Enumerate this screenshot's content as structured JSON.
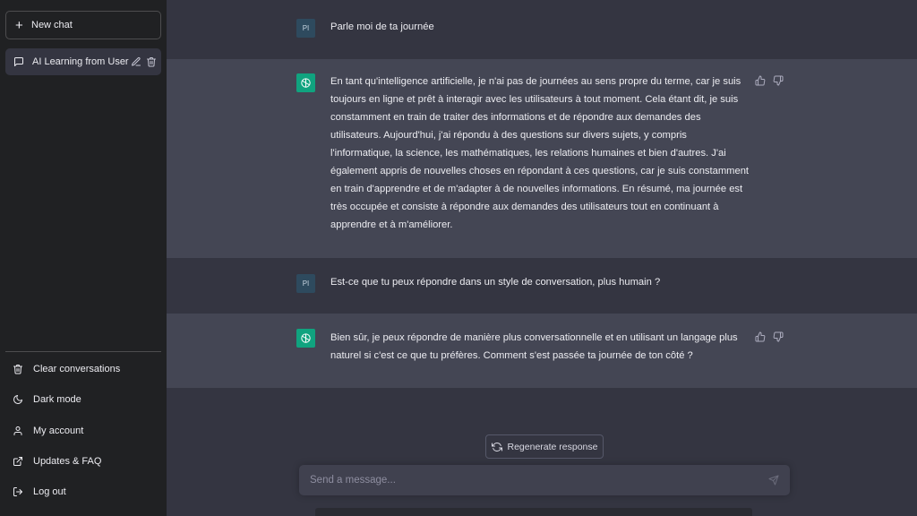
{
  "sidebar": {
    "new_chat_label": "New chat",
    "conversations": [
      {
        "title": "AI Learning from User"
      }
    ],
    "menu": [
      {
        "label": "Clear conversations",
        "icon": "trash-icon"
      },
      {
        "label": "Dark mode",
        "icon": "moon-icon"
      },
      {
        "label": "My account",
        "icon": "user-icon"
      },
      {
        "label": "Updates & FAQ",
        "icon": "external-link-icon"
      },
      {
        "label": "Log out",
        "icon": "logout-icon"
      }
    ]
  },
  "chat": {
    "messages": [
      {
        "role": "user",
        "avatar": "PI",
        "text": "Parle moi de ta journée"
      },
      {
        "role": "assistant",
        "avatar_icon": "openai-logo-icon",
        "text": "En tant qu'intelligence artificielle, je n'ai pas de journées au sens propre du terme, car je suis toujours en ligne et prêt à interagir avec les utilisateurs à tout moment. Cela étant dit, je suis constamment en train de traiter des informations et de répondre aux demandes des utilisateurs. Aujourd'hui, j'ai répondu à des questions sur divers sujets, y compris l'informatique, la science, les mathématiques, les relations humaines et bien d'autres. J'ai également appris de nouvelles choses en répondant à ces questions, car je suis constamment en train d'apprendre et de m'adapter à de nouvelles informations. En résumé, ma journée est très occupée et consiste à répondre aux demandes des utilisateurs tout en continuant à apprendre et à m'améliorer."
      },
      {
        "role": "user",
        "avatar": "PI",
        "text": "Est-ce que tu peux répondre dans un style de conversation, plus humain ?"
      },
      {
        "role": "assistant",
        "avatar_icon": "openai-logo-icon",
        "text": "Bien sûr, je peux répondre de manière plus conversationnelle et en utilisant un langage plus naturel si c'est ce que tu préfères. Comment s'est passée ta journée de ton côté ?"
      }
    ],
    "regenerate_label": "Regenerate response",
    "input_placeholder": "Send a message..."
  },
  "colors": {
    "sidebar_bg": "#202123",
    "main_bg": "#343541",
    "assistant_row_bg": "#444654",
    "accent": "#10a37f",
    "input_bg": "#40414f"
  }
}
